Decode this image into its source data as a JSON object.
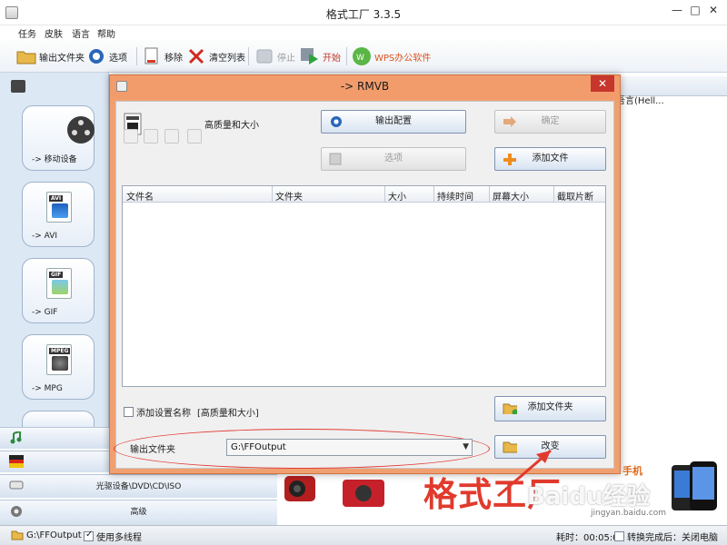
{
  "main_window": {
    "title": "格式工厂 3.3.5",
    "controls": [
      "—",
      "□",
      "✕"
    ]
  },
  "menu": [
    "任务",
    "皮肤",
    "语言",
    "帮助"
  ],
  "toolbar": {
    "output_folder": "输出文件夹",
    "options": "选项",
    "remove": "移除",
    "clear_list": "清空列表",
    "stop": "停止",
    "start": "开始",
    "wps": "WPS办公软件"
  },
  "left_panel": {
    "categories": [
      {
        "label": "-> 移动设备"
      },
      {
        "label": "-> AVI",
        "tag": "AVI"
      },
      {
        "label": "-> GIF",
        "tag": "GIF"
      },
      {
        "label": "-> MPG",
        "tag": "MPEG"
      }
    ],
    "bottom_rows": [
      {
        "label": ""
      },
      {
        "label": ""
      },
      {
        "label": "光驱设备\\DVD\\CD\\ISO"
      },
      {
        "label": "高级"
      }
    ]
  },
  "right_partial_text": "吾言(Hell...",
  "dialog": {
    "title": "-> RMVB",
    "quality_label": "高质量和大小",
    "output_config_button": "输出配置",
    "ok_button": "确定",
    "options_button": "选项",
    "add_file_button": "添加文件",
    "table_columns": [
      "文件名",
      "文件夹",
      "大小",
      "持续时间",
      "屏幕大小",
      "截取片断"
    ],
    "preset_checkbox_label": "添加设置名称",
    "preset_name": "[高质量和大小]",
    "add_folder_button": "添加文件夹",
    "output_folder_label": "输出文件夹",
    "output_folder_value": "G:\\FFOutput",
    "change_button": "改变"
  },
  "annotation": {
    "text": "格式工厂",
    "color": "#e13a2d"
  },
  "watermark": {
    "text": "Baidu经验",
    "sub": "jingyan.baidu.com"
  },
  "promo": {
    "partial_label": "手机"
  },
  "statusbar": {
    "path": "G:\\FFOutput",
    "multithread": "使用多线程",
    "elapsed": "耗时：00:05:02",
    "after_done": "转换完成后：关闭电脑"
  },
  "colors": {
    "dialog_border": "#f0a070",
    "accent_blue": "#2a66b8",
    "close_red": "#c7362c"
  }
}
